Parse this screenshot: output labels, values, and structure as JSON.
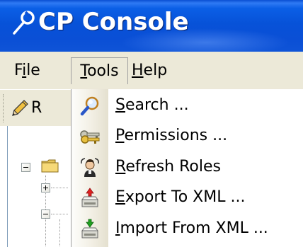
{
  "window": {
    "title": "CP Console"
  },
  "menubar": {
    "file": {
      "label": "File",
      "mnemonic": "i"
    },
    "tools": {
      "label": "Tools",
      "mnemonic": "T"
    },
    "help": {
      "label": "Help",
      "mnemonic": "H"
    }
  },
  "toolbar": {
    "partial_label": "R"
  },
  "tools_menu": {
    "items": [
      {
        "pre": "",
        "mnem": "S",
        "post": "earch ...",
        "icon": "magnifier-icon"
      },
      {
        "pre": "",
        "mnem": "P",
        "post": "ermissions ...",
        "icon": "keys-icon"
      },
      {
        "pre": "",
        "mnem": "R",
        "post": "efresh Roles",
        "icon": "user-refresh-icon"
      },
      {
        "pre": "",
        "mnem": "E",
        "post": "xport To XML ...",
        "icon": "export-drive-icon"
      },
      {
        "pre": "",
        "mnem": "I",
        "post": "mport From XML ...",
        "icon": "import-drive-icon"
      }
    ]
  },
  "colors": {
    "titlebar": "#0752d8",
    "menu_bg": "#ece9d8",
    "dropdown_bg": "#ffffff",
    "export_arrow": "#e02020",
    "import_arrow": "#20a020"
  }
}
